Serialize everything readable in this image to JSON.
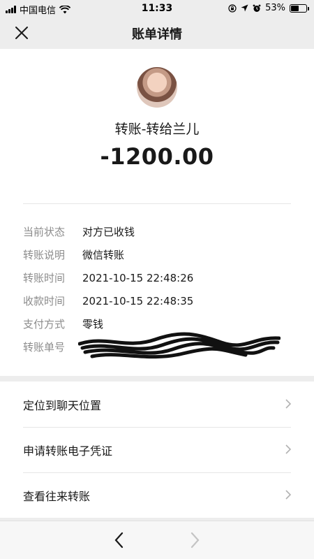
{
  "status_bar": {
    "carrier": "中国电信",
    "time": "11:33",
    "battery_percent": "53%",
    "battery_level": 0.53,
    "icons": [
      "signal-icon",
      "wifi-icon",
      "screen-lock-icon",
      "location-icon",
      "alarm-icon",
      "battery-icon"
    ]
  },
  "nav": {
    "title": "账单详情",
    "close_icon": "close-icon"
  },
  "transaction": {
    "payee": "转账-转给兰儿",
    "amount": "-1200.00",
    "details": [
      {
        "label": "当前状态",
        "value": "对方已收钱"
      },
      {
        "label": "转账说明",
        "value": "微信转账"
      },
      {
        "label": "转账时间",
        "value": "2021-10-15 22:48:26"
      },
      {
        "label": "收款时间",
        "value": "2021-10-15 22:48:35"
      },
      {
        "label": "支付方式",
        "value": "零钱"
      },
      {
        "label": "转账单号",
        "value": ""
      }
    ]
  },
  "actions": [
    {
      "label": "定位到聊天位置"
    },
    {
      "label": "申请转账电子凭证"
    },
    {
      "label": "查看往来转账"
    }
  ],
  "toolbar": {
    "back_icon": "chevron-left-icon",
    "forward_icon": "chevron-right-icon"
  }
}
